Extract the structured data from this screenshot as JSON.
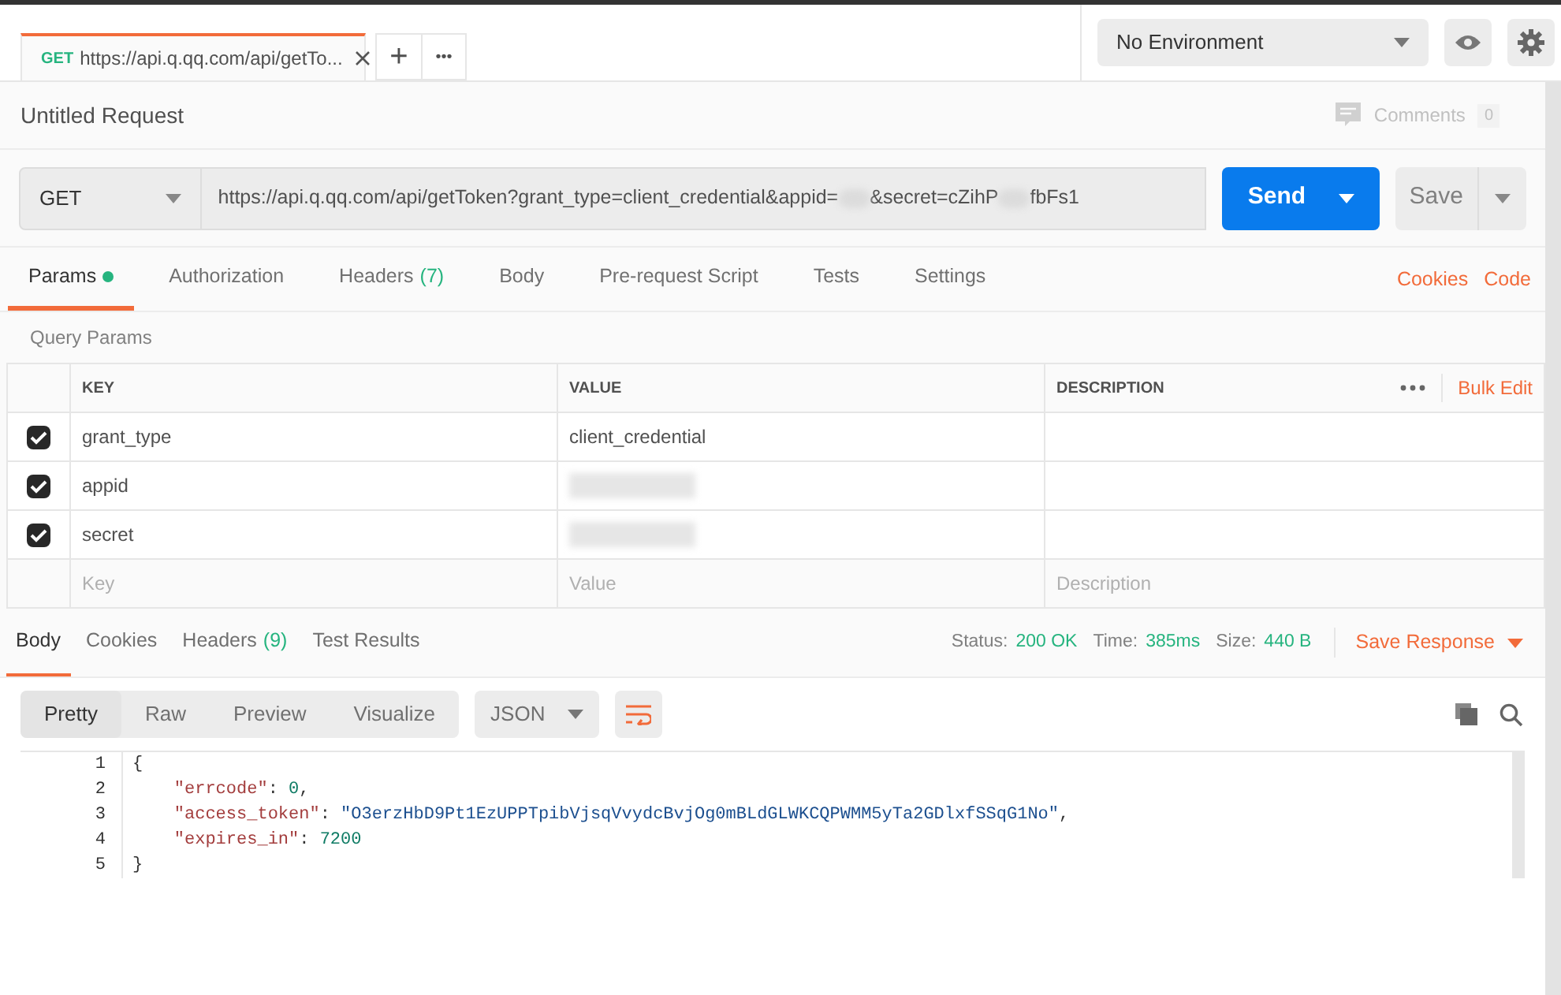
{
  "request_tabs": [
    {
      "method": "GET",
      "title": "https://api.q.qq.com/api/getTo...",
      "selected": true
    }
  ],
  "new_tab_button": "+",
  "tab_menu_button": "•••",
  "environment": {
    "label": "No Environment"
  },
  "request_name": "Untitled Request",
  "comments": {
    "label": "Comments",
    "count": "0"
  },
  "method": "GET",
  "url_segments": [
    {
      "kind": "text",
      "text": "https://api.q.qq.com/api/getToken?grant_type=client_credential&appid="
    },
    {
      "kind": "redacted"
    },
    {
      "kind": "text",
      "text": "&secret=cZihP"
    },
    {
      "kind": "redacted"
    },
    {
      "kind": "text",
      "text": "fbFs1"
    }
  ],
  "send_button": "Send",
  "save_button": "Save",
  "request_tabs_bar": [
    {
      "label": "Params",
      "dot": true,
      "selected": true
    },
    {
      "label": "Authorization",
      "dot": false,
      "selected": false
    },
    {
      "label": "Headers",
      "badge": "(7)",
      "dot": false,
      "selected": false
    },
    {
      "label": "Body",
      "dot": false,
      "selected": false
    },
    {
      "label": "Pre-request Script",
      "dot": false,
      "selected": false
    },
    {
      "label": "Tests",
      "dot": false,
      "selected": false
    },
    {
      "label": "Settings",
      "dot": false,
      "selected": false
    }
  ],
  "request_links": [
    "Cookies",
    "Code"
  ],
  "query_params": {
    "title": "Query Params",
    "columns": [
      "KEY",
      "VALUE",
      "DESCRIPTION"
    ],
    "bulk_edit": "Bulk Edit",
    "rows": [
      {
        "checked": true,
        "key": "grant_type",
        "value": "client_credential",
        "redacted": false
      },
      {
        "checked": true,
        "key": "appid",
        "redacted": true
      },
      {
        "checked": true,
        "key": "secret",
        "redacted": true
      }
    ],
    "placeholders": {
      "key": "Key",
      "value": "Value",
      "description": "Description"
    }
  },
  "response_tabs": [
    {
      "label": "Body",
      "selected": true
    },
    {
      "label": "Cookies",
      "selected": false
    },
    {
      "label": "Headers",
      "badge": "(9)",
      "selected": false
    },
    {
      "label": "Test Results",
      "selected": false
    }
  ],
  "response_meta": [
    {
      "label": "Status:",
      "value": "200 OK"
    },
    {
      "label": "Time:",
      "value": "385ms"
    },
    {
      "label": "Size:",
      "value": "440 B"
    }
  ],
  "save_response": "Save Response",
  "view_modes": [
    {
      "label": "Pretty",
      "selected": true
    },
    {
      "label": "Raw",
      "selected": false
    },
    {
      "label": "Preview",
      "selected": false
    },
    {
      "label": "Visualize",
      "selected": false
    }
  ],
  "format": "JSON",
  "code_lines": [
    {
      "number": "1",
      "tokens": [
        {
          "kind": "punct",
          "text": "{"
        }
      ]
    },
    {
      "number": "2",
      "tokens": [
        {
          "kind": "key",
          "text": "    \"errcode\""
        },
        {
          "kind": "punct",
          "text": ": "
        },
        {
          "kind": "number",
          "text": "0"
        },
        {
          "kind": "punct",
          "text": ","
        }
      ]
    },
    {
      "number": "3",
      "tokens": [
        {
          "kind": "key",
          "text": "    \"access_token\""
        },
        {
          "kind": "punct",
          "text": ": "
        },
        {
          "kind": "string",
          "text": "\"O3erzHbD9Pt1EzUPPTpibVjsqVvydcBvjOg0mBLdGLWKCQPWMM5yTa2GDlxfSSqG1No\""
        },
        {
          "kind": "punct",
          "text": ","
        }
      ]
    },
    {
      "number": "4",
      "tokens": [
        {
          "kind": "key",
          "text": "    \"expires_in\""
        },
        {
          "kind": "punct",
          "text": ": "
        },
        {
          "kind": "number",
          "text": "7200"
        }
      ]
    },
    {
      "number": "5",
      "tokens": [
        {
          "kind": "punct",
          "text": "}"
        }
      ]
    }
  ]
}
